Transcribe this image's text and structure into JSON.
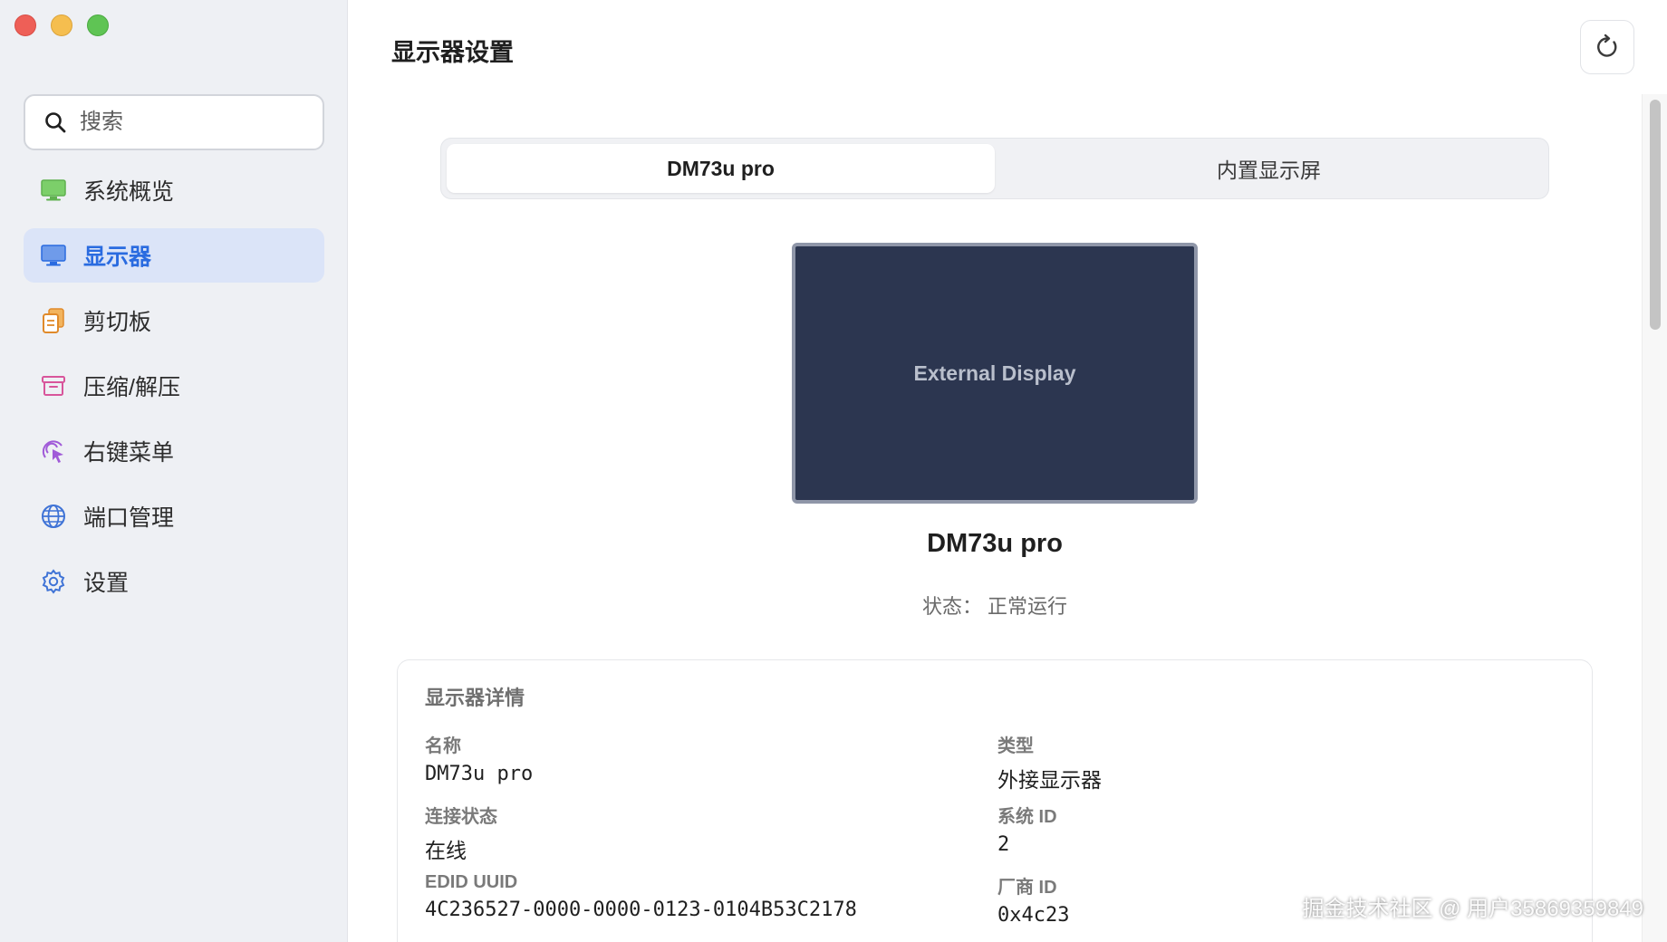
{
  "window": {
    "traffic_lights": {
      "close": "#ee5f57",
      "minimize": "#f5be4f",
      "maximize": "#5fc454"
    }
  },
  "sidebar": {
    "search_placeholder": "搜索",
    "items": [
      {
        "label": "系统概览",
        "icon": "monitor-green-icon",
        "active": false
      },
      {
        "label": "显示器",
        "icon": "display-icon",
        "active": true
      },
      {
        "label": "剪切板",
        "icon": "clipboard-icon",
        "active": false
      },
      {
        "label": "压缩/解压",
        "icon": "archive-icon",
        "active": false
      },
      {
        "label": "右键菜单",
        "icon": "pointer-click-icon",
        "active": false
      },
      {
        "label": "端口管理",
        "icon": "globe-icon",
        "active": false
      },
      {
        "label": "设置",
        "icon": "gear-icon",
        "active": false
      }
    ]
  },
  "header": {
    "title": "显示器设置",
    "refresh_icon": "refresh-icon"
  },
  "tabs": [
    {
      "label": "DM73u pro",
      "active": true
    },
    {
      "label": "内置显示屏",
      "active": false
    }
  ],
  "preview": {
    "label": "External Display"
  },
  "display": {
    "name": "DM73u pro",
    "status": "状态： 正常运行"
  },
  "details": {
    "title": "显示器详情",
    "fields": [
      {
        "label": "名称",
        "value": "DM73u pro"
      },
      {
        "label": "类型",
        "value": "外接显示器"
      },
      {
        "label": "连接状态",
        "value": "在线"
      },
      {
        "label": "系统 ID",
        "value": "2"
      },
      {
        "label": "EDID UUID",
        "value": "4C236527-0000-0000-0123-0104B53C2178"
      },
      {
        "label": "厂商 ID",
        "value": "0x4c23"
      }
    ]
  },
  "watermark": "掘金技术社区 @ 用户35869359849",
  "colors": {
    "accent": "#2a6be0",
    "sidebar_bg": "#eef0f4",
    "active_item_bg": "#dbe4f8",
    "preview_bg": "#2c3650"
  }
}
